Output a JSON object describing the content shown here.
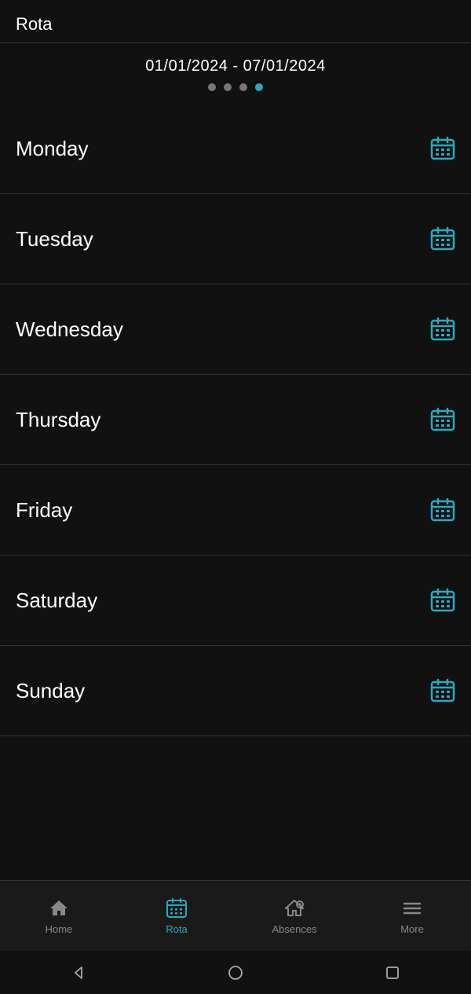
{
  "header": {
    "title": "Rota"
  },
  "dateRange": {
    "text": "01/01/2024 - 07/01/2024",
    "dots": [
      {
        "active": false
      },
      {
        "active": false
      },
      {
        "active": false
      },
      {
        "active": true
      }
    ]
  },
  "days": [
    {
      "label": "Monday"
    },
    {
      "label": "Tuesday"
    },
    {
      "label": "Wednesday"
    },
    {
      "label": "Thursday"
    },
    {
      "label": "Friday"
    },
    {
      "label": "Saturday"
    },
    {
      "label": "Sunday"
    }
  ],
  "bottomNav": {
    "items": [
      {
        "label": "Home",
        "active": false,
        "icon": "home"
      },
      {
        "label": "Rota",
        "active": true,
        "icon": "calendar"
      },
      {
        "label": "Absences",
        "active": false,
        "icon": "absences"
      },
      {
        "label": "More",
        "active": false,
        "icon": "menu"
      }
    ]
  },
  "colors": {
    "accent": "#2aaabf",
    "background": "#111111",
    "text": "#ffffff",
    "muted": "#888888",
    "divider": "#333333"
  }
}
